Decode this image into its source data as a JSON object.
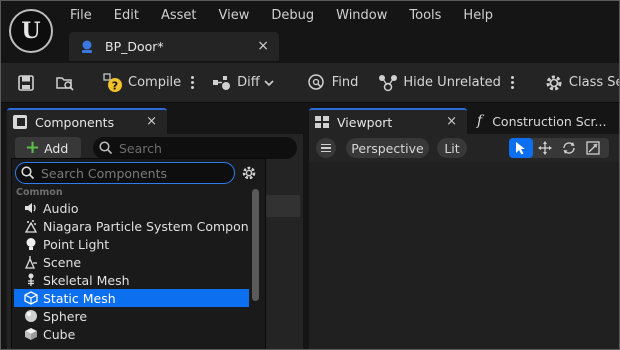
{
  "menu": [
    "File",
    "Edit",
    "Asset",
    "View",
    "Debug",
    "Window",
    "Tools",
    "Help"
  ],
  "doc_tab": {
    "title": "BP_Door*",
    "close": "×"
  },
  "toolbar": {
    "compile": "Compile",
    "diff": "Diff",
    "find": "Find",
    "hide_unrelated": "Hide Unrelated",
    "class_settings": "Class Se"
  },
  "components_tab": {
    "title": "Components",
    "close": "×"
  },
  "components_panel": {
    "add_label": "Add",
    "search_placeholder": "Search"
  },
  "add_dropdown": {
    "search_placeholder": "Search Components",
    "category": "Common",
    "items": [
      {
        "label": "Audio",
        "icon": "speaker-icon"
      },
      {
        "label": "Niagara Particle System Component",
        "icon": "particle-system-icon"
      },
      {
        "label": "Point Light",
        "icon": "light-bulb-icon"
      },
      {
        "label": "Scene",
        "icon": "scene-icon"
      },
      {
        "label": "Skeletal Mesh",
        "icon": "skeleton-icon"
      },
      {
        "label": "Static Mesh",
        "icon": "static-mesh-icon",
        "selected": true
      },
      {
        "label": "Sphere",
        "icon": "sphere-icon"
      },
      {
        "label": "Cube",
        "icon": "cube-icon"
      }
    ]
  },
  "viewport_tab": {
    "title": "Viewport",
    "close": "×"
  },
  "construction_tab": {
    "title": "Construction Scr..."
  },
  "viewport": {
    "perspective": "Perspective",
    "lit": "Lit"
  },
  "colors": {
    "accent": "#0c6ff0",
    "add_plus": "#5bbf4a",
    "panel": "#242424",
    "background": "#151515"
  }
}
